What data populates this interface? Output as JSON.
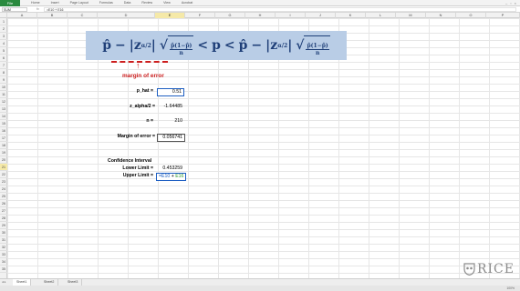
{
  "ribbon": {
    "file_tab": "File",
    "tabs": [
      "Home",
      "Insert",
      "Page Layout",
      "Formulas",
      "Data",
      "Review",
      "View",
      "Acrobat"
    ]
  },
  "formula_bar": {
    "name_box": "SUM",
    "fx": "fx",
    "content": "=E10 + E16"
  },
  "columns": [
    "A",
    "B",
    "C",
    "D",
    "E",
    "F",
    "G",
    "H",
    "I",
    "J",
    "K",
    "L",
    "M",
    "N",
    "O",
    "P"
  ],
  "active_column": "E",
  "rows": [
    "1",
    "2",
    "3",
    "4",
    "5",
    "6",
    "7",
    "8",
    "9",
    "10",
    "11",
    "12",
    "13",
    "14",
    "15",
    "16",
    "17",
    "18",
    "19",
    "20",
    "21",
    "22",
    "23",
    "24",
    "25",
    "26",
    "27",
    "28",
    "29",
    "30",
    "31",
    "32",
    "33",
    "34",
    "35"
  ],
  "active_row": "21",
  "formula_banner": {
    "p_hat": "p̂",
    "minus": "−",
    "z_crit": "|z",
    "z_sub": "α/2",
    "z_close": "|",
    "sqrt_num": "p̂(1−p̂)",
    "sqrt_den": "n",
    "lt": "<",
    "p": "p",
    "lt2": "<"
  },
  "annotation": {
    "margin_label": "margin of error",
    "arrow": "↑"
  },
  "cells": {
    "p_hat_label": "p_hat =",
    "p_hat_value": "0.51",
    "z_label": "z_alpha/2 =",
    "z_value": "-1.64485",
    "n_label": "n =",
    "n_value": "210",
    "moe_label": "Margin of error =",
    "moe_value": "0.056741",
    "ci_heading": "Confidence Interval",
    "lower_label": "Lower Limit =",
    "lower_value": "0.453259",
    "upper_label": "Upper Limit =",
    "upper_e10": "=E10",
    "upper_plus": " + ",
    "upper_e16": "E16"
  },
  "sheets": [
    "Sheet1",
    "Sheet2",
    "Sheet3"
  ],
  "active_sheet": "Sheet1",
  "status": {
    "zoom": "100%"
  },
  "watermark": {
    "text": "RICE"
  }
}
